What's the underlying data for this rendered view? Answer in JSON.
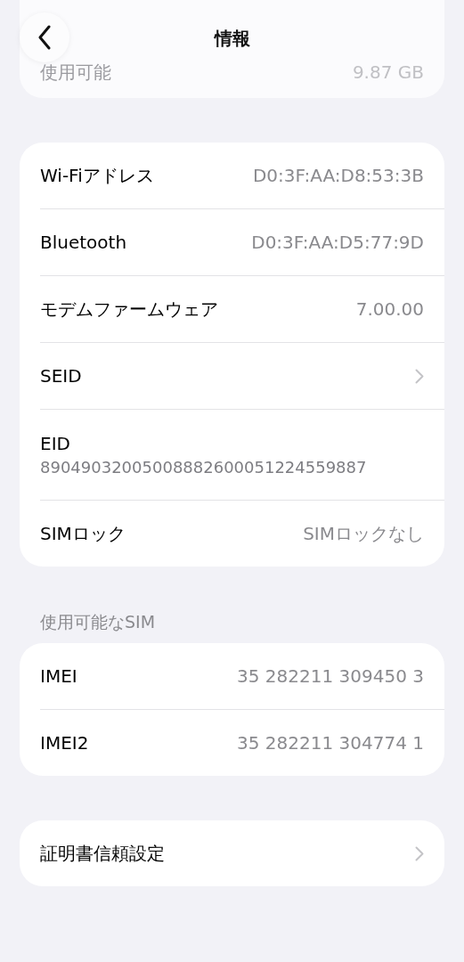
{
  "header": {
    "title": "情報"
  },
  "storage_card": {
    "rows": [
      {
        "label": "使用可能",
        "value": "9.87 GB"
      }
    ]
  },
  "groups": [
    {
      "rows": [
        {
          "kind": "value",
          "label": "Wi-Fiアドレス",
          "value": "D0:3F:AA:D8:53:3B"
        },
        {
          "kind": "value",
          "label": "Bluetooth",
          "value": "D0:3F:AA:D5:77:9D"
        },
        {
          "kind": "value",
          "label": "モデムファームウェア",
          "value": "7.00.00"
        },
        {
          "kind": "chevron",
          "label": "SEID"
        },
        {
          "kind": "stacked",
          "label": "EID",
          "value": "89049032005008882600051224559887"
        },
        {
          "kind": "value",
          "label": "SIMロック",
          "value": "SIMロックなし"
        }
      ]
    },
    {
      "section_title": "使用可能なSIM",
      "rows": [
        {
          "kind": "value",
          "label": "IMEI",
          "value": "35 282211 309450 3"
        },
        {
          "kind": "value",
          "label": "IMEI2",
          "value": "35 282211 304774 1"
        }
      ]
    },
    {
      "rows": [
        {
          "kind": "chevron",
          "label": "証明書信頼設定"
        }
      ]
    }
  ]
}
